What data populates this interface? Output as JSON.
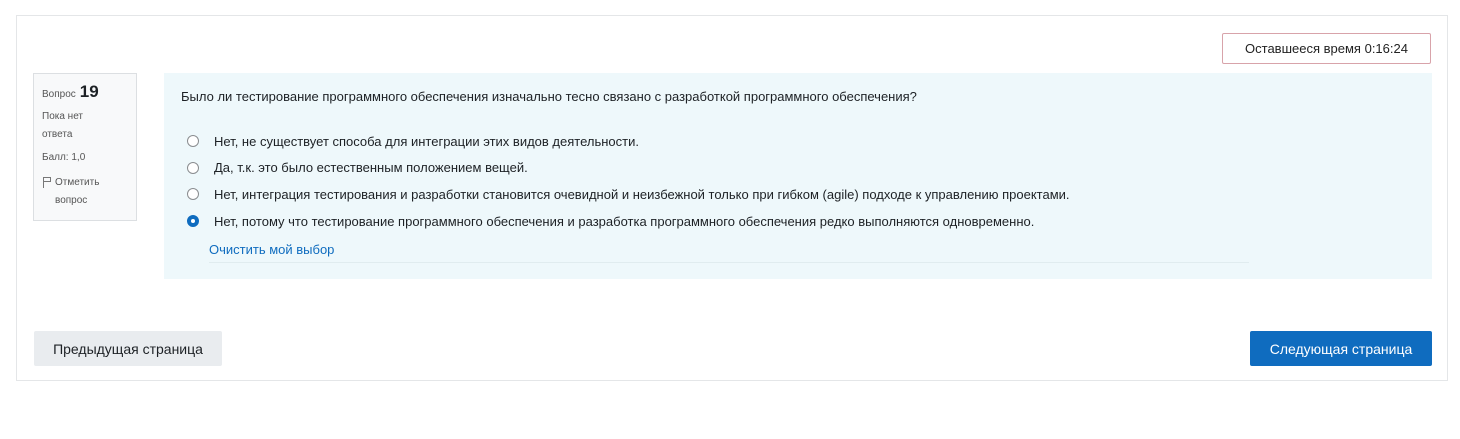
{
  "timer": {
    "text": "Оставшееся время 0:16:24"
  },
  "question_info": {
    "label": "Вопрос",
    "number": "19",
    "state": "Пока нет ответа",
    "grade": "Балл: 1,0",
    "flag_label": "Отметить вопрос"
  },
  "question": {
    "text": "Было ли тестирование программного обеспечения изначально тесно связано с разработкой программного обеспечения?",
    "answers": [
      {
        "label": "Нет, не существует способа для интеграции этих видов деятельности.",
        "selected": false
      },
      {
        "label": "Да, т.к. это было естественным положением вещей.",
        "selected": false
      },
      {
        "label": "Нет, интеграция тестирования и разработки становится очевидной и неизбежной только при гибком (agile) подходе к управлению проектами.",
        "selected": false
      },
      {
        "label": "Нет, потому что тестирование программного обеспечения и разработка программного обеспечения редко выполняются одновременно.",
        "selected": true
      }
    ],
    "clear_choice": "Очистить мой выбор"
  },
  "navigation": {
    "prev_label": "Предыдущая страница",
    "next_label": "Следующая страница"
  },
  "colors": {
    "accent": "#0f6cbf",
    "question_bg": "#eef8fb",
    "timer_border": "#d8a3aa"
  }
}
